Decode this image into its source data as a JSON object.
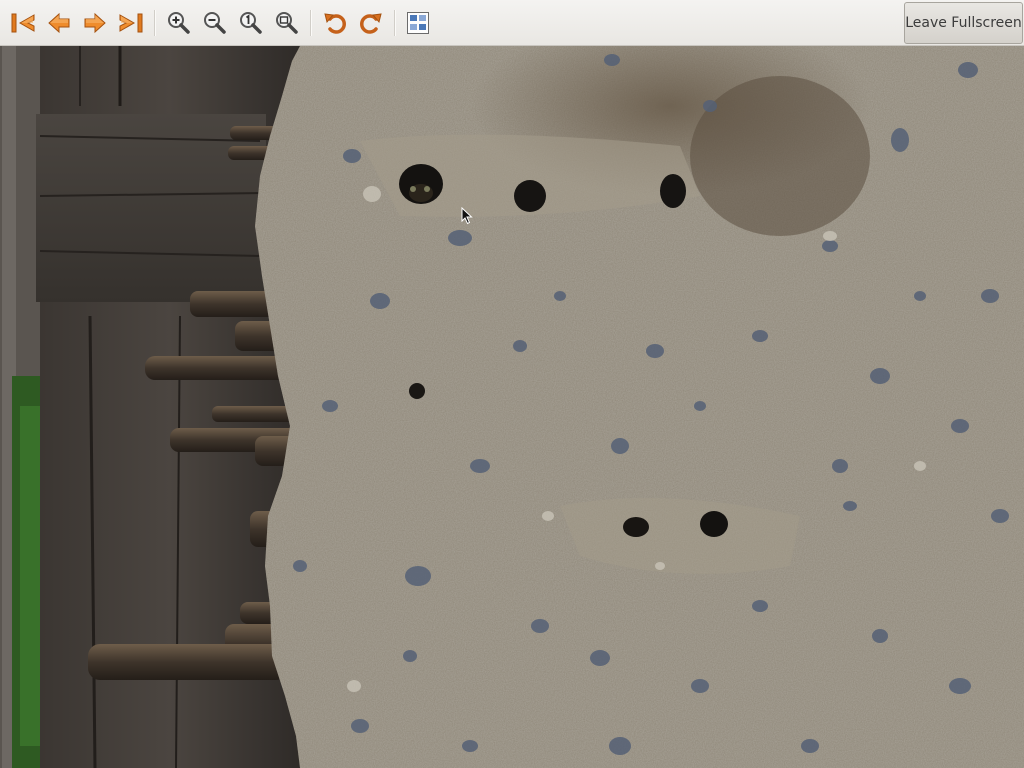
{
  "toolbar": {
    "buttons": [
      {
        "name": "first-image",
        "icon": "go-first-icon"
      },
      {
        "name": "previous-image",
        "icon": "go-previous-icon"
      },
      {
        "name": "next-image",
        "icon": "go-next-icon"
      },
      {
        "name": "last-image",
        "icon": "go-last-icon"
      },
      {
        "name": "zoom-in",
        "icon": "zoom-in-icon"
      },
      {
        "name": "zoom-out",
        "icon": "zoom-out-icon"
      },
      {
        "name": "zoom-normal",
        "icon": "zoom-normal-icon"
      },
      {
        "name": "zoom-fit",
        "icon": "zoom-fit-icon"
      },
      {
        "name": "rotate-left",
        "icon": "rotate-left-icon"
      },
      {
        "name": "rotate-right",
        "icon": "rotate-right-icon"
      },
      {
        "name": "gallery",
        "icon": "gallery-icon"
      }
    ],
    "leave_fullscreen_label": "Leave Fullscreen"
  },
  "colors": {
    "nav_orange": "#e07a1f",
    "toolbar_bg": "#efedea",
    "wall_mud": "#8f8778",
    "wood_dark": "#3a3531"
  },
  "viewer": {
    "image_subject": "mud nest wall with bee holes"
  }
}
